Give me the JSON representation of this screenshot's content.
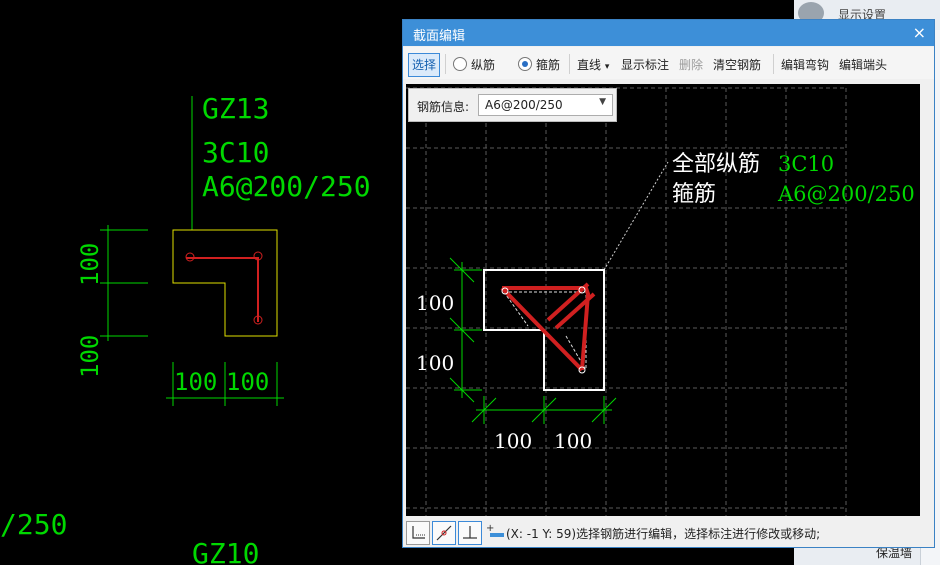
{
  "background": {
    "label1": "GZ13",
    "label2": "3C10",
    "label3": "A6@200/250",
    "dim_left_top": "100",
    "dim_left_bottom": "100",
    "dim_bottom_left": "100",
    "dim_bottom_right": "100",
    "fragment_left": "/250",
    "fragment_bottom": "GZ10"
  },
  "right_panel": {
    "title": "显示设置",
    "bottom_label": "保温墙"
  },
  "dialog": {
    "title": "截面编辑",
    "close": "×",
    "toolbar": {
      "select": "选择",
      "longitudinal": "纵筋",
      "stirrup": "箍筋",
      "line": "直线",
      "line_arrow": "▾",
      "show_annotation": "显示标注",
      "delete": "删除",
      "clear_rebar": "清空钢筋",
      "edit_hook": "编辑弯钩",
      "edit_end": "编辑端头"
    },
    "rebar_info": {
      "label": "钢筋信息:",
      "value": "A6@200/250"
    },
    "canvas": {
      "label_all_long": "全部纵筋",
      "value_all_long": "3C10",
      "label_stirrup": "箍筋",
      "value_stirrup": "A6@200/250",
      "dim_v_top": "100",
      "dim_v_bottom": "100",
      "dim_h_left": "100",
      "dim_h_right": "100"
    },
    "status": "(X: -1 Y: 59)选择钢筋进行编辑，选择标注进行修改或移动;"
  },
  "colors": {
    "cad_green": "#00d800",
    "rebar_red": "#d02020",
    "title_blue": "#3d8fd8"
  }
}
